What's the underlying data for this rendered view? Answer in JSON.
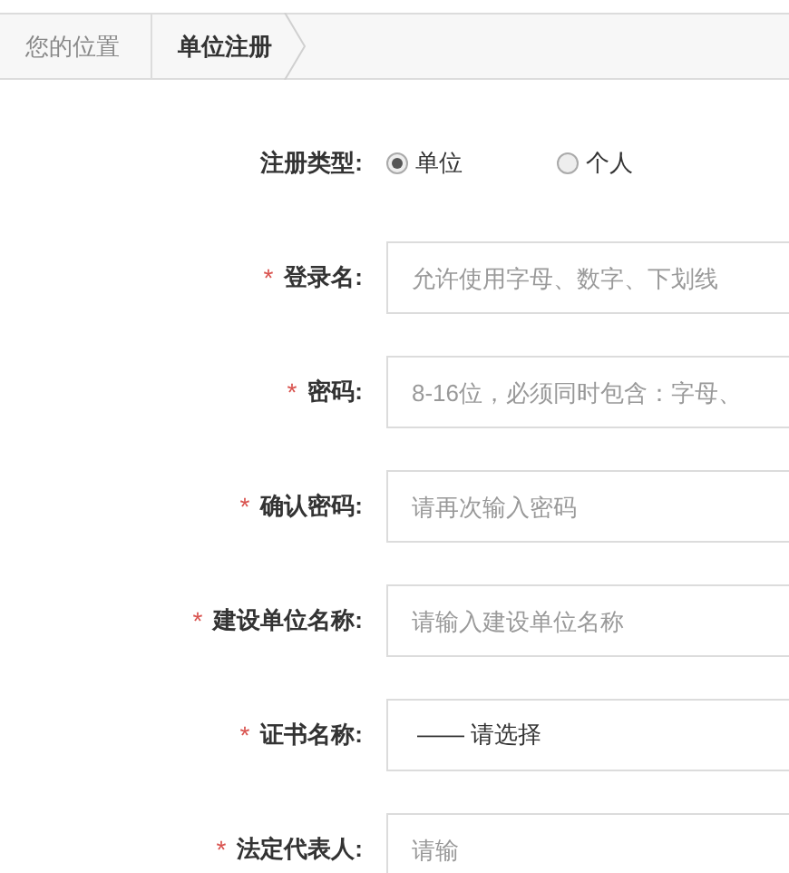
{
  "breadcrumb": {
    "label": "您的位置",
    "current": "单位注册"
  },
  "form": [
    {
      "kind": "radio",
      "label": "注册类型:",
      "options": [
        {
          "label": "单位",
          "selected": true
        },
        {
          "label": "个人",
          "selected": false
        }
      ]
    },
    {
      "kind": "input",
      "marker": "*",
      "label": "登录名:",
      "placeholder": "允许使用字母、数字、下划线"
    },
    {
      "kind": "input",
      "marker": "*",
      "label": "密码:",
      "placeholder": "8-16位，必须同时包含：字母、"
    },
    {
      "kind": "input",
      "marker": "*",
      "label": "确认密码:",
      "placeholder": "请再次输入密码"
    },
    {
      "kind": "input",
      "marker": "*",
      "label": "建设单位名称:",
      "placeholder": "请输入建设单位名称"
    },
    {
      "kind": "select",
      "marker": "*",
      "label": "证书名称:",
      "value": "—— 请选择"
    },
    {
      "kind": "input",
      "marker": "*",
      "label": "法定代表人:",
      "placeholder": "请输"
    }
  ]
}
